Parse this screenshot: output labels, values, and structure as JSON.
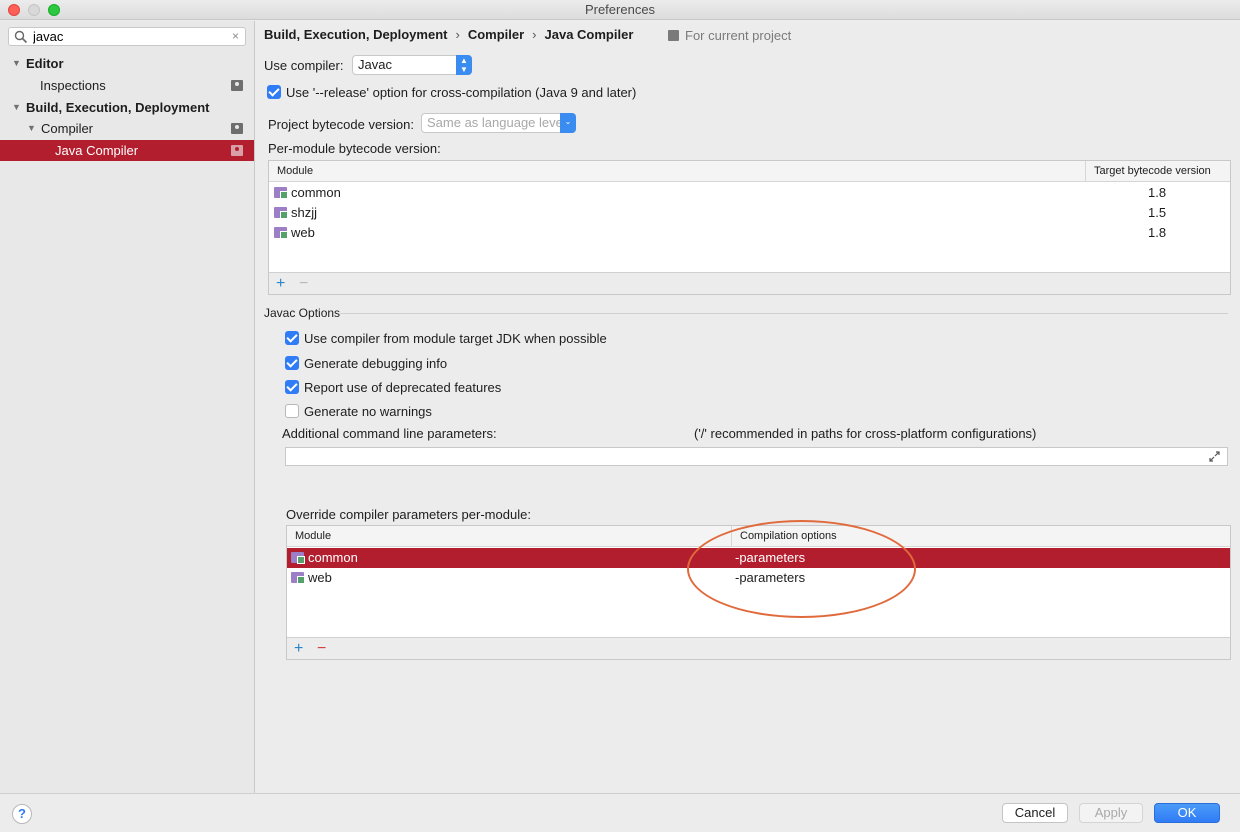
{
  "window": {
    "title": "Preferences"
  },
  "search": {
    "value": "javac",
    "clear_glyph": "×"
  },
  "sidebar": {
    "items": [
      {
        "label": "Editor",
        "bold": true,
        "expanded": true
      },
      {
        "label": "Inspections",
        "bold": false
      },
      {
        "label": "Build, Execution, Deployment",
        "bold": true,
        "expanded": true
      },
      {
        "label": "Compiler",
        "bold": false,
        "expanded": true
      },
      {
        "label": "Java Compiler",
        "bold": false,
        "selected": true
      }
    ]
  },
  "breadcrumb": {
    "items": [
      "Build, Execution, Deployment",
      "Compiler",
      "Java Compiler"
    ],
    "separator": "›"
  },
  "for_project": "For current project",
  "compiler": {
    "label": "Use compiler:",
    "value": "Javac"
  },
  "release_option": {
    "label": "Use '--release' option for cross-compilation (Java 9 and later)",
    "checked": true
  },
  "bytecode": {
    "label": "Project bytecode version:",
    "value": "Same as language level"
  },
  "per_module": {
    "label": "Per-module bytecode version:",
    "headers": [
      "Module",
      "Target bytecode version"
    ],
    "rows": [
      {
        "module": "common",
        "version": "1.8"
      },
      {
        "module": "shzjj",
        "version": "1.5"
      },
      {
        "module": "web",
        "version": "1.8"
      }
    ],
    "add": "+",
    "remove": "−"
  },
  "javac_options": {
    "title": "Javac Options",
    "checkboxes": [
      {
        "label": "Use compiler from module target JDK when possible",
        "checked": true
      },
      {
        "label": "Generate debugging info",
        "checked": true
      },
      {
        "label": "Report use of deprecated features",
        "checked": true
      },
      {
        "label": "Generate no warnings",
        "checked": false
      }
    ],
    "additional_label": "Additional command line parameters:",
    "additional_hint": "('/' recommended in paths for cross-platform configurations)",
    "additional_value": ""
  },
  "override": {
    "label": "Override compiler parameters per-module:",
    "headers": [
      "Module",
      "Compilation options"
    ],
    "rows": [
      {
        "module": "common",
        "options": "-parameters",
        "selected": true
      },
      {
        "module": "web",
        "options": "-parameters",
        "selected": false
      }
    ],
    "add": "+",
    "remove": "−"
  },
  "buttons": {
    "help": "?",
    "cancel": "Cancel",
    "apply": "Apply",
    "ok": "OK"
  },
  "colors": {
    "selection": "#b31e2e",
    "accent": "#2f7cf6",
    "annotation": "#e06a3c"
  }
}
